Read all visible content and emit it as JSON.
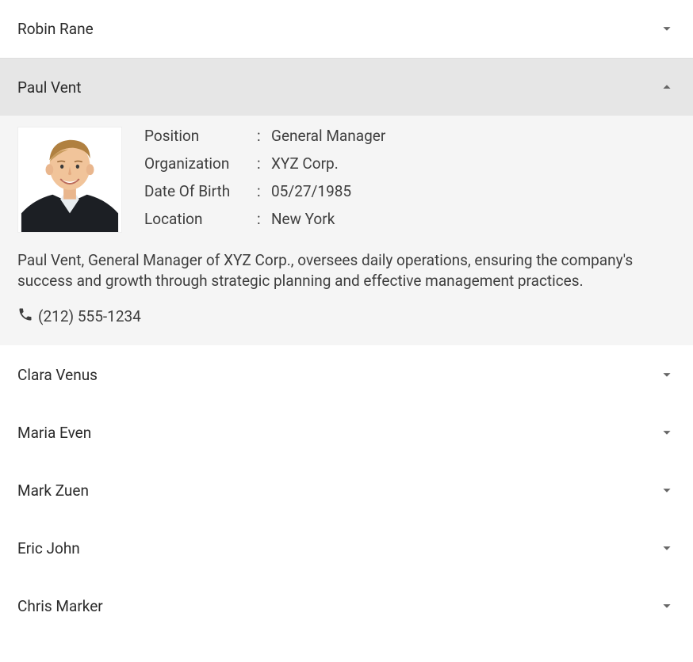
{
  "accordion": {
    "items": [
      {
        "name": "Robin Rane",
        "expanded": false
      },
      {
        "name": "Paul Vent",
        "expanded": true,
        "details": {
          "position_label": "Position",
          "position_value": "General Manager",
          "org_label": "Organization",
          "org_value": "XYZ Corp.",
          "dob_label": "Date Of Birth",
          "dob_value": "05/27/1985",
          "location_label": "Location",
          "location_value": "New York",
          "bio": "Paul Vent, General Manager of XYZ Corp., oversees daily operations, ensuring the company's success and growth through strategic planning and effective management practices.",
          "phone": "(212) 555-1234"
        }
      },
      {
        "name": "Clara Venus",
        "expanded": false
      },
      {
        "name": "Maria Even",
        "expanded": false
      },
      {
        "name": "Mark Zuen",
        "expanded": false
      },
      {
        "name": "Eric John",
        "expanded": false
      },
      {
        "name": "Chris Marker",
        "expanded": false
      }
    ]
  },
  "icons": {
    "chevron_down": "chevron-down-icon",
    "chevron_up": "chevron-up-icon",
    "phone": "phone-icon",
    "avatar": "avatar-image"
  }
}
